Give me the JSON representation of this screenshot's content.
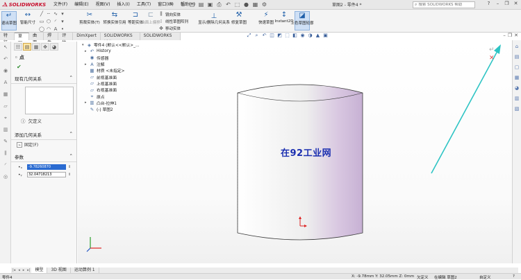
{
  "titlebar": {
    "logo": "SOLIDWORKS",
    "menus": [
      "文件(F)",
      "编辑(E)",
      "视图(V)",
      "插入(I)",
      "工具(T)",
      "窗口(W)",
      "帮助(H)"
    ],
    "doc_title": "草图2 - 零件4 *",
    "search_placeholder": "搜索 SOLIDWORKS 帮助"
  },
  "ribbon": {
    "exit_sketch": "退出草图",
    "smart_dim": "智能尺寸",
    "trim": "剪裁实体(T)",
    "convert": "转换实体引用",
    "offset": "等距实体",
    "surface_offset": "曲面上偏移",
    "mirror": "镜向实体",
    "linear_pattern": "线性草图阵列",
    "move": "移动实体",
    "relations": "显示/删除几何关系",
    "repair": "修复草图",
    "rapid": "快速草图",
    "instant2d": "Instant2D",
    "shade": "上色草图轮廓"
  },
  "tabs": [
    "特征",
    "草图",
    "曲面",
    "焊件",
    "评估",
    "DimXpert",
    "SOLIDWORKS 插件",
    "SOLIDWORKS MBD"
  ],
  "property_manager": {
    "title": "点",
    "existing_relations": "现有几何关系",
    "status": "欠定义",
    "add_relations": "添加几何关系",
    "fix": "固定(F)",
    "parameters": "参数",
    "x_value": "-9.78260870",
    "y_value": "32.04718213"
  },
  "tree": [
    {
      "label": "零件4 (默认<<默认>_...",
      "icon": "part",
      "expand": "▾"
    },
    {
      "label": "History",
      "icon": "history",
      "expand": "▸"
    },
    {
      "label": "传感器",
      "icon": "sensor",
      "expand": ""
    },
    {
      "label": "注解",
      "icon": "annotation",
      "expand": "▸"
    },
    {
      "label": "材质 <未指定>",
      "icon": "material",
      "expand": ""
    },
    {
      "label": "前视基准面",
      "icon": "plane",
      "expand": ""
    },
    {
      "label": "上视基准面",
      "icon": "plane",
      "expand": ""
    },
    {
      "label": "右视基准面",
      "icon": "plane",
      "expand": ""
    },
    {
      "label": "原点",
      "icon": "origin",
      "expand": ""
    },
    {
      "label": "凸台-拉伸1",
      "icon": "extrude",
      "expand": "▸"
    },
    {
      "label": "(-) 草图2",
      "icon": "sketch",
      "expand": ""
    }
  ],
  "watermark": "在92工业网",
  "bottom_tabs": [
    "模型",
    "3D 视图",
    "运动算例 1"
  ],
  "status": {
    "doc": "零件4",
    "coords": "X: -9.78mm Y: 32.05mm Z: 0mm",
    "definition": "欠定义",
    "editing": "在编辑 草图2",
    "units": "自定义"
  },
  "colors": {
    "accent": "#1f5fa9",
    "brand": "#c8102e",
    "cylinder_tint": "#d8c6e0",
    "arrow": "#2ec4c4"
  }
}
